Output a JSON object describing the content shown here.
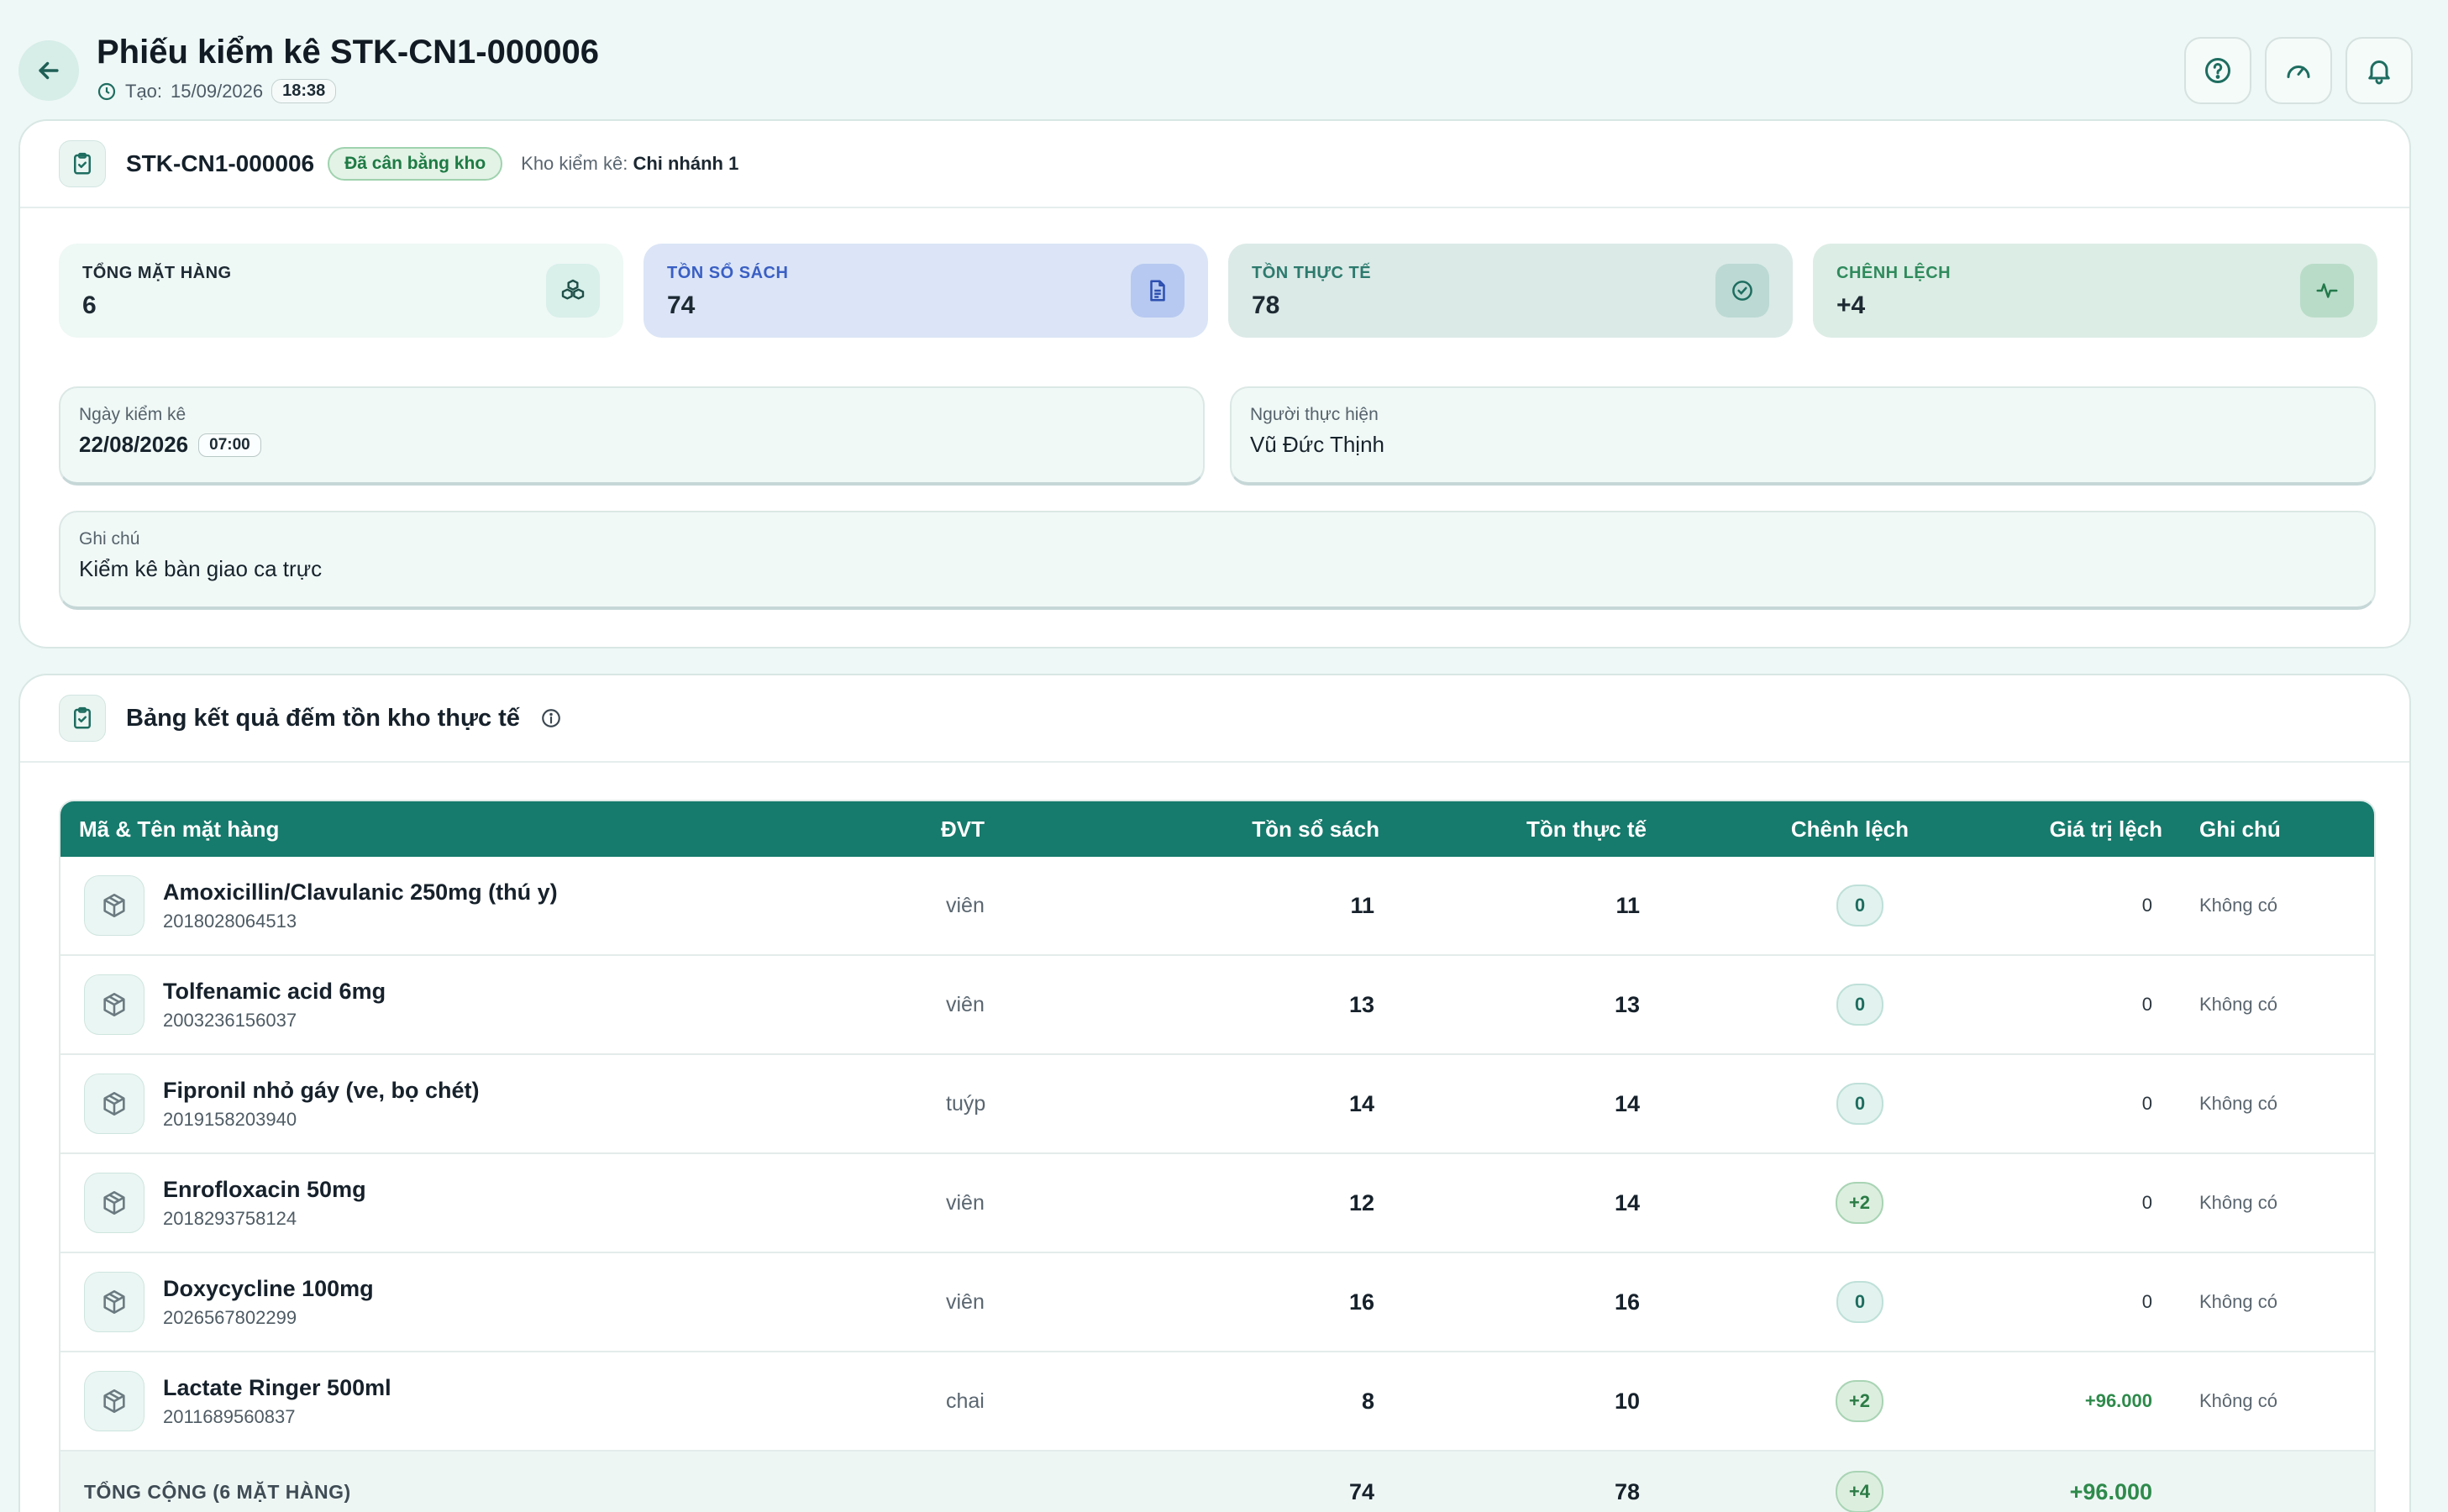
{
  "header": {
    "title": "Phiếu kiểm kê STK-CN1-000006",
    "created_label": "Tạo:",
    "created_date": "15/09/2026",
    "created_time": "18:38"
  },
  "summary": {
    "code": "STK-CN1-000006",
    "status": "Đã cân bằng kho",
    "warehouse_label": "Kho kiểm kê:",
    "warehouse_value": "Chi nhánh 1",
    "stats": [
      {
        "label": "Tổng mặt hàng",
        "value": "6"
      },
      {
        "label": "Tồn sổ sách",
        "value": "74"
      },
      {
        "label": "Tồn thực tế",
        "value": "78"
      },
      {
        "label": "Chênh lệch",
        "value": "+4"
      }
    ],
    "count_date_label": "Ngày kiểm kê",
    "count_date": "22/08/2026",
    "count_time": "07:00",
    "person_label": "Người thực hiện",
    "person": "Vũ Đức Thịnh",
    "note_label": "Ghi chú",
    "note": "Kiểm kê bàn giao ca trực"
  },
  "table": {
    "title": "Bảng kết quả đếm tồn kho thực tế",
    "columns": [
      "Mã & Tên mặt hàng",
      "ĐVT",
      "Tồn sổ sách",
      "Tồn thực tế",
      "Chênh lệch",
      "Giá trị lệch",
      "Ghi chú"
    ],
    "rows": [
      {
        "name": "Amoxicillin/Clavulanic 250mg (thú y)",
        "code": "2018028064513",
        "unit": "viên",
        "book": "11",
        "real": "11",
        "diff": "0",
        "value": "0",
        "note": "Không có"
      },
      {
        "name": "Tolfenamic acid 6mg",
        "code": "2003236156037",
        "unit": "viên",
        "book": "13",
        "real": "13",
        "diff": "0",
        "value": "0",
        "note": "Không có"
      },
      {
        "name": "Fipronil nhỏ gáy (ve, bọ chét)",
        "code": "2019158203940",
        "unit": "tuýp",
        "book": "14",
        "real": "14",
        "diff": "0",
        "value": "0",
        "note": "Không có"
      },
      {
        "name": "Enrofloxacin 50mg",
        "code": "2018293758124",
        "unit": "viên",
        "book": "12",
        "real": "14",
        "diff": "+2",
        "value": "0",
        "note": "Không có"
      },
      {
        "name": "Doxycycline 100mg",
        "code": "2026567802299",
        "unit": "viên",
        "book": "16",
        "real": "16",
        "diff": "0",
        "value": "0",
        "note": "Không có"
      },
      {
        "name": "Lactate Ringer 500ml",
        "code": "2011689560837",
        "unit": "chai",
        "book": "8",
        "real": "10",
        "diff": "+2",
        "value": "+96.000",
        "note": "Không có"
      }
    ],
    "footer": {
      "label": "TỔNG CỘNG (6 MẶT HÀNG)",
      "book": "74",
      "real": "78",
      "diff": "+4",
      "value": "+96.000"
    }
  },
  "icons": {
    "back": "arrow-left-icon",
    "help": "help-circle-icon",
    "dashboard": "gauge-icon",
    "notifications": "bell-icon",
    "clock": "clock-icon",
    "clipboard": "clipboard-check-icon",
    "item": "package-icon"
  },
  "colors": {
    "primary": "#167a6c",
    "background": "#eef8f6",
    "positive": "#2e8a4b"
  }
}
